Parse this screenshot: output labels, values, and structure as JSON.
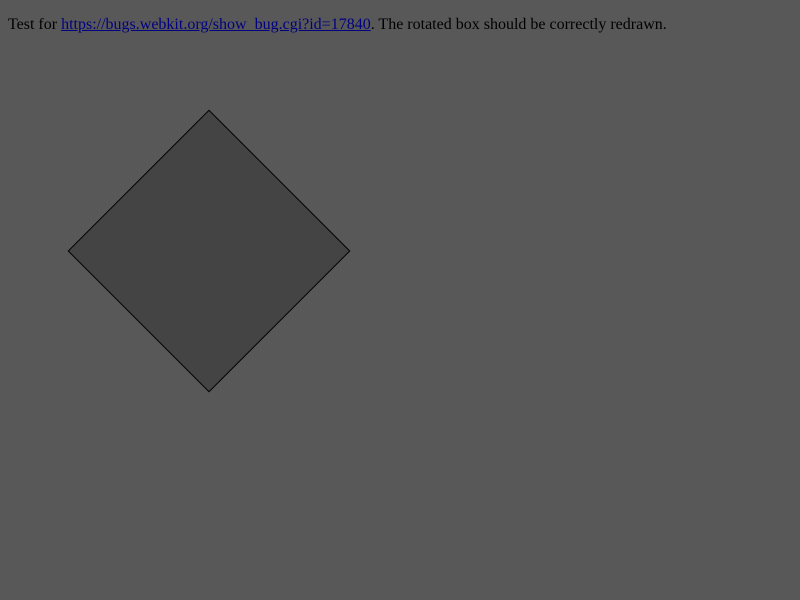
{
  "description": {
    "prefix": "Test for ",
    "link_text": "https://bugs.webkit.org/show_bug.cgi?id=17840",
    "suffix": ". The rotated box should be correctly redrawn."
  },
  "colors": {
    "page_background": "#585858",
    "box_fill": "#444444",
    "box_border": "#000000",
    "link": "#000080"
  }
}
